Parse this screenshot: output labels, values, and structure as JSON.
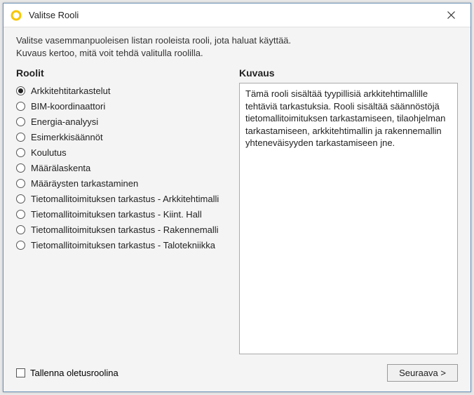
{
  "window": {
    "title": "Valitse Rooli"
  },
  "intro": {
    "line1": "Valitse vasemmanpuoleisen listan rooleista rooli, jota haluat käyttää.",
    "line2": "Kuvaus kertoo, mitä voit tehdä valitulla roolilla."
  },
  "roles": {
    "heading": "Roolit",
    "items": [
      "Arkkitehtitarkastelut",
      "BIM-koordinaattori",
      "Energia-analyysi",
      "Esimerkkisäännöt",
      "Koulutus",
      "Määrälaskenta",
      "Määräysten tarkastaminen",
      "Tietomallitoimituksen tarkastus - Arkkitehtimalli",
      "Tietomallitoimituksen tarkastus - Kiint. Hall",
      "Tietomallitoimituksen tarkastus - Rakennemalli",
      "Tietomallitoimituksen tarkastus - Talotekniikka"
    ],
    "selected_index": 0
  },
  "description": {
    "heading": "Kuvaus",
    "text": "Tämä rooli sisältää tyypillisiä arkkitehtimallille tehtäviä tarkastuksia. Rooli sisältää säännöstöjä tietomallitoimituksen tarkastamiseen, tilaohjelman tarkastamiseen, arkkitehtimallin ja rakennemallin yhteneväisyyden tarkastamiseen jne."
  },
  "footer": {
    "save_default_label": "Tallenna oletusroolina",
    "next_label": "Seuraava >"
  },
  "colors": {
    "accent": "#f7c600"
  }
}
